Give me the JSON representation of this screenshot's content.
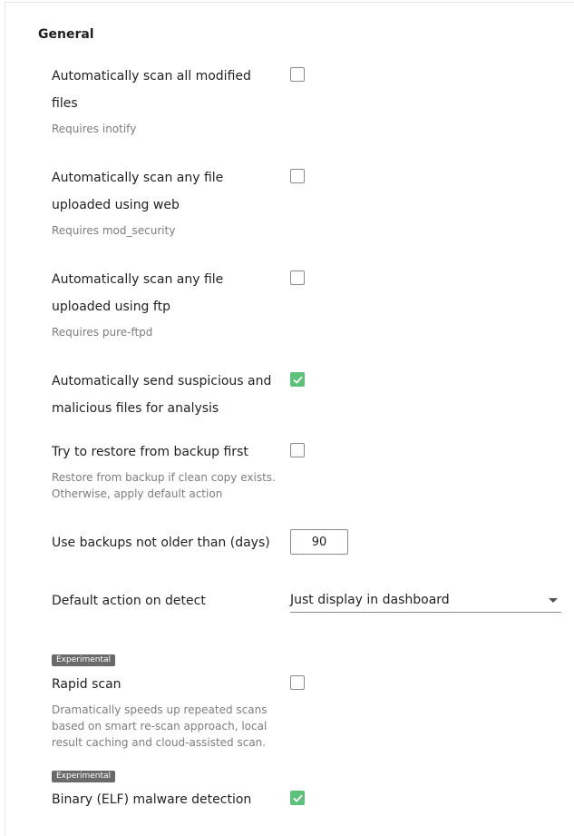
{
  "section": {
    "title": "General"
  },
  "settings": {
    "scan_modified": {
      "label_line1": "Automatically scan all modified",
      "label_line2": "files",
      "desc": "Requires inotify",
      "checked": false
    },
    "scan_web": {
      "label_line1": "Automatically scan any file",
      "label_line2": "uploaded using web",
      "desc": "Requires mod_security",
      "checked": false
    },
    "scan_ftp": {
      "label_line1": "Automatically scan any file",
      "label_line2": "uploaded using ftp",
      "desc": "Requires pure-ftpd",
      "checked": false
    },
    "send_suspicious": {
      "label_line1": "Automatically send suspicious and",
      "label_line2": "malicious files for analysis",
      "checked": true
    },
    "restore_backup": {
      "label": "Try to restore from backup first",
      "desc_line1": "Restore from backup if clean copy exists.",
      "desc_line2": "Otherwise, apply default action",
      "checked": false
    },
    "backup_age": {
      "label": "Use backups not older than (days)",
      "value": "90"
    },
    "default_action": {
      "label": "Default action on detect",
      "selected": "Just display in dashboard"
    },
    "rapid_scan": {
      "badge": "Experimental",
      "label": "Rapid scan",
      "desc_line1": "Dramatically speeds up repeated scans",
      "desc_line2": "based on smart re-scan approach, local",
      "desc_line3": "result caching and cloud-assisted scan.",
      "checked": false
    },
    "elf_detection": {
      "badge": "Experimental",
      "label": "Binary (ELF) malware detection",
      "checked": true
    }
  },
  "colors": {
    "checked": "#5cc17a",
    "checkbox_border": "#8a8a8a",
    "badge_bg": "#6a6a6a",
    "muted_text": "#7d7d7d"
  },
  "icons": {
    "check": "checkmark-icon",
    "dropdown": "caret-down-icon"
  }
}
